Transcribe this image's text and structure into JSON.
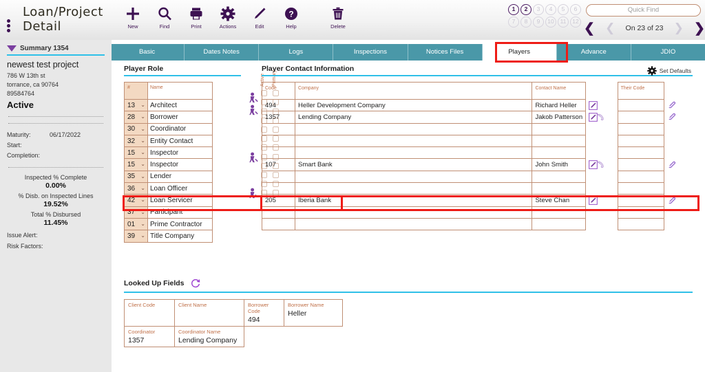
{
  "header": {
    "title": "Loan/Project Detail",
    "tools": [
      {
        "name": "new",
        "label": "New"
      },
      {
        "name": "find",
        "label": "Find"
      },
      {
        "name": "print",
        "label": "Print"
      },
      {
        "name": "actions",
        "label": "Actions"
      },
      {
        "name": "edit",
        "label": "Edit"
      },
      {
        "name": "help",
        "label": "Help"
      },
      {
        "name": "delete",
        "label": "Delete"
      }
    ],
    "pager_dots": [
      "1",
      "2",
      "3",
      "4",
      "5",
      "6",
      "7",
      "8",
      "9",
      "10",
      "11",
      "12"
    ],
    "pager_active": [
      "1",
      "2"
    ],
    "quick_find_placeholder": "Quick Find",
    "record_counter": "On 23 of 23",
    "accent_purple": "#3d1152",
    "accent_teal": "#4a98a8",
    "accent_cyan": "#2fc0e8",
    "highlight_red": "#ee1c16"
  },
  "tabs": [
    {
      "label": "Basic",
      "active": false
    },
    {
      "label": "Dates Notes",
      "active": false
    },
    {
      "label": "Logs",
      "active": false
    },
    {
      "label": "Inspections",
      "active": false
    },
    {
      "label": "Notices Files",
      "active": false
    },
    {
      "label": "Players",
      "active": true
    },
    {
      "label": "Advance",
      "active": false
    },
    {
      "label": "JDIO",
      "active": false
    }
  ],
  "sidebar": {
    "summary_label": "Summary 1354",
    "project_name": "newest test project",
    "address1": "786 W 13th st",
    "address2": "torrance, ca  90764",
    "account": "89584764",
    "status": "Active",
    "maturity_label": "Maturity:",
    "maturity_value": "06/17/2022",
    "start_label": "Start:",
    "start_value": "",
    "completion_label": "Completion:",
    "completion_value": "",
    "inspected_label": "Inspected % Complete",
    "inspected_value": "0.00%",
    "disb_label": "% Disb. on Inspected Lines",
    "disb_value": "19.52%",
    "total_label": "Total % Disbursed",
    "total_value": "11.45%",
    "issue_alert_label": "Issue Alert:",
    "risk_factors_label": "Risk Factors:"
  },
  "player_role": {
    "title": "Player Role",
    "col_num": "#",
    "col_name": "Name",
    "col_active": "Active",
    "col_primary": "Primary",
    "rows": [
      {
        "num": "13",
        "name": "Architect",
        "active": false,
        "primary": false
      },
      {
        "num": "28",
        "name": "Borrower",
        "active": false,
        "primary": false
      },
      {
        "num": "30",
        "name": "Coordinator",
        "active": false,
        "primary": false
      },
      {
        "num": "32",
        "name": "Entity Contact",
        "active": false,
        "primary": false
      },
      {
        "num": "15",
        "name": "Inspector",
        "active": false,
        "primary": false
      },
      {
        "num": "15",
        "name": "Inspector",
        "active": false,
        "primary": false
      },
      {
        "num": "35",
        "name": "Lender",
        "active": false,
        "primary": false
      },
      {
        "num": "36",
        "name": "Loan Officer",
        "active": false,
        "primary": false
      },
      {
        "num": "42",
        "name": "Loan Servicer",
        "active": false,
        "primary": false
      },
      {
        "num": "37",
        "name": "Participant",
        "active": false,
        "primary": false
      },
      {
        "num": "01",
        "name": "Prime Contractor",
        "active": false,
        "primary": false
      },
      {
        "num": "39",
        "name": "Title Company",
        "active": false,
        "primary": false
      }
    ]
  },
  "player_contact": {
    "title": "Player Contact Information",
    "set_defaults_label": "Set Defaults",
    "col_code": "Code",
    "col_company": "Company",
    "col_contact": "Contact Name",
    "col_their_code": "Their Code",
    "rows": [
      {
        "person": true,
        "code": "494",
        "company": "Heller Development Company",
        "contact": "Richard Heller",
        "their_code": "",
        "edit": true,
        "phone": false,
        "clip": true
      },
      {
        "person": true,
        "code": "1357",
        "company": "Lending Company",
        "contact": "Jakob Patterson",
        "their_code": "",
        "edit": true,
        "phone": true,
        "clip": true
      },
      {
        "person": false,
        "code": "",
        "company": "",
        "contact": "",
        "their_code": "",
        "edit": false,
        "phone": false,
        "clip": false
      },
      {
        "person": false,
        "code": "",
        "company": "",
        "contact": "",
        "their_code": "",
        "edit": false,
        "phone": false,
        "clip": false
      },
      {
        "person": false,
        "code": "",
        "company": "",
        "contact": "",
        "their_code": "",
        "edit": false,
        "phone": false,
        "clip": false
      },
      {
        "person": true,
        "code": "107",
        "company": "Smart Bank",
        "contact": "John Smith",
        "their_code": "",
        "edit": true,
        "phone": true,
        "clip": true
      },
      {
        "person": false,
        "code": "",
        "company": "",
        "contact": "",
        "their_code": "",
        "edit": false,
        "phone": false,
        "clip": false
      },
      {
        "person": false,
        "code": "",
        "company": "",
        "contact": "",
        "their_code": "",
        "edit": false,
        "phone": false,
        "clip": false
      },
      {
        "person": true,
        "code": "205",
        "company": "Iberia Bank",
        "contact": "Steve Chan",
        "their_code": "",
        "edit": true,
        "phone": false,
        "clip": true
      },
      {
        "person": false,
        "code": "",
        "company": "",
        "contact": "",
        "their_code": "",
        "edit": false,
        "phone": false,
        "clip": false
      },
      {
        "person": false,
        "code": "",
        "company": "",
        "contact": "",
        "their_code": "",
        "edit": false,
        "phone": false,
        "clip": false
      }
    ]
  },
  "lookup": {
    "title": "Looked Up Fields",
    "client_code_label": "Client Code",
    "client_code_value": "",
    "client_name_label": "Client Name",
    "client_name_value": "",
    "borrower_code_label": "Borrower Code",
    "borrower_code_value": "494",
    "borrower_name_label": "Borrower Name",
    "borrower_name_value": "Heller",
    "coordinator_label": "Coordinator",
    "coordinator_value": "1357",
    "coordinator_name_label": "Coordinator Name",
    "coordinator_name_value": "Lending Company"
  }
}
